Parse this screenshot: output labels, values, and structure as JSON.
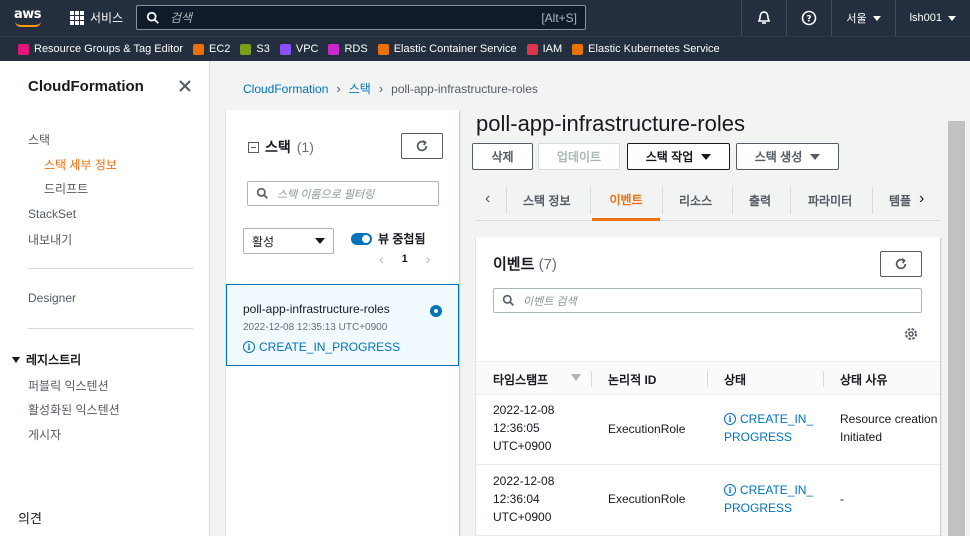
{
  "topnav": {
    "logo_text": "aws",
    "services_label": "서비스",
    "search_placeholder": "검색",
    "search_shortcut": "[Alt+S]",
    "region": "서울",
    "user": "lsh001"
  },
  "favorites": [
    {
      "label": "Resource Groups & Tag Editor",
      "color": "#e7157b"
    },
    {
      "label": "EC2",
      "color": "#ed7100"
    },
    {
      "label": "S3",
      "color": "#7aa116"
    },
    {
      "label": "VPC",
      "color": "#8c4fff"
    },
    {
      "label": "RDS",
      "color": "#c925d1"
    },
    {
      "label": "Elastic Container Service",
      "color": "#ed7100"
    },
    {
      "label": "IAM",
      "color": "#dd344c"
    },
    {
      "label": "Elastic Kubernetes Service",
      "color": "#ed7100"
    }
  ],
  "sidebar": {
    "title": "CloudFormation",
    "stacks": "스택",
    "stack_details": "스택 세부 정보",
    "drift": "드리프트",
    "stackset": "StackSet",
    "exports": "내보내기",
    "designer": "Designer",
    "registry": "레지스트리",
    "public_ext": "퍼블릭 익스텐션",
    "activated_ext": "활성화된 익스텐션",
    "publisher": "게시자",
    "feedback": "의견"
  },
  "breadcrumb": [
    "CloudFormation",
    "스택",
    "poll-app-infrastructure-roles"
  ],
  "stack_list": {
    "title": "스택",
    "count": "(1)",
    "filter_placeholder": "스택 이름으로 필터링",
    "status_filter": "활성",
    "nested_view": "뷰 중첩됨",
    "page": "1",
    "stack": {
      "name": "poll-app-infrastructure-roles",
      "time": "2022-12-08 12:35:13 UTC+0900",
      "status": "CREATE_IN_PROGRESS"
    }
  },
  "detail": {
    "title": "poll-app-infrastructure-roles",
    "buttons": {
      "delete": "삭제",
      "update": "업데이트",
      "stack_actions": "스택 작업",
      "create_stack": "스택 생성"
    },
    "tabs": [
      "스택 정보",
      "이벤트",
      "리소스",
      "출력",
      "파라미터",
      "템플"
    ],
    "events": {
      "title": "이벤트",
      "count": "(7)",
      "search_placeholder": "이벤트 검색",
      "columns": [
        "타임스탬프",
        "논리적 ID",
        "상태",
        "상태 사유"
      ],
      "rows": [
        {
          "ts1": "2022-12-08",
          "ts2": "12:36:05",
          "ts3": "UTC+0900",
          "logical_id": "ExecutionRole",
          "status1": "CREATE_IN_",
          "status2": "PROGRESS",
          "reason1": "Resource creation",
          "reason2": "Initiated"
        },
        {
          "ts1": "2022-12-08",
          "ts2": "12:36:04",
          "ts3": "UTC+0900",
          "logical_id": "ExecutionRole",
          "status1": "CREATE_IN_",
          "status2": "PROGRESS",
          "reason1": "-",
          "reason2": ""
        }
      ]
    }
  }
}
